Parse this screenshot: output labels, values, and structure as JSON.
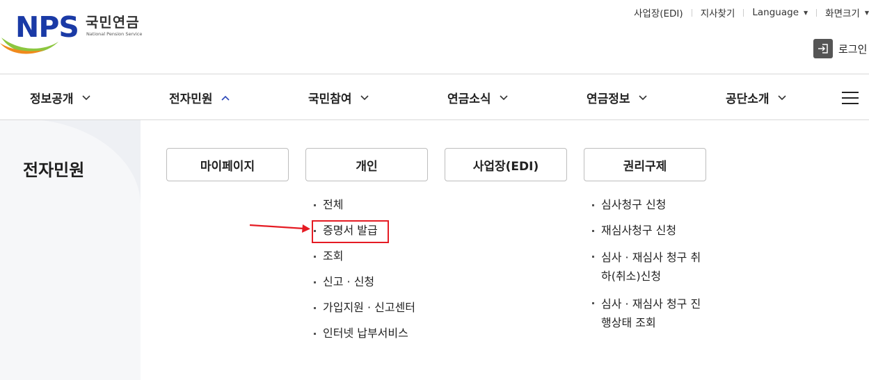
{
  "logo": {
    "nps": "NPS",
    "korean": "국민연금",
    "english": "National Pension Service"
  },
  "util_links": [
    {
      "label": "사업장(EDI)"
    },
    {
      "label": "지사찾기"
    },
    {
      "label": "Language",
      "icon": "caret-down-icon"
    },
    {
      "label": "화면크기",
      "icon": "caret-down-icon"
    }
  ],
  "login": {
    "label": "로그인",
    "icon": "login-icon"
  },
  "gnb": {
    "items": [
      {
        "label": "정보공개",
        "state": "collapsed"
      },
      {
        "label": "전자민원",
        "state": "expanded"
      },
      {
        "label": "국민참여",
        "state": "collapsed"
      },
      {
        "label": "연금소식",
        "state": "collapsed"
      },
      {
        "label": "연금정보",
        "state": "collapsed"
      },
      {
        "label": "공단소개",
        "state": "collapsed"
      }
    ],
    "menu_icon": "hamburger-icon"
  },
  "submenu": {
    "section_title": "전자민원",
    "categories": [
      {
        "label": "마이페이지",
        "items": []
      },
      {
        "label": "개인",
        "items": [
          "전체",
          "증명서 발급",
          "조회",
          "신고 · 신청",
          "가입지원 · 신고센터",
          "인터넷 납부서비스"
        ]
      },
      {
        "label": "사업장(EDI)",
        "items": []
      },
      {
        "label": "권리구제",
        "items": [
          "심사청구 신청",
          "재심사청구 신청",
          "심사 · 재심사 청구 취하(취소)신청",
          "심사 · 재심사 청구 진행상태 조회"
        ]
      }
    ]
  },
  "annotation": {
    "highlighted_item": "증명서 발급",
    "color": "#e51b23"
  },
  "colors": {
    "brand_blue": "#1a3aa6",
    "brand_orange": "#f08a1c",
    "brand_green": "#8cc63f"
  }
}
